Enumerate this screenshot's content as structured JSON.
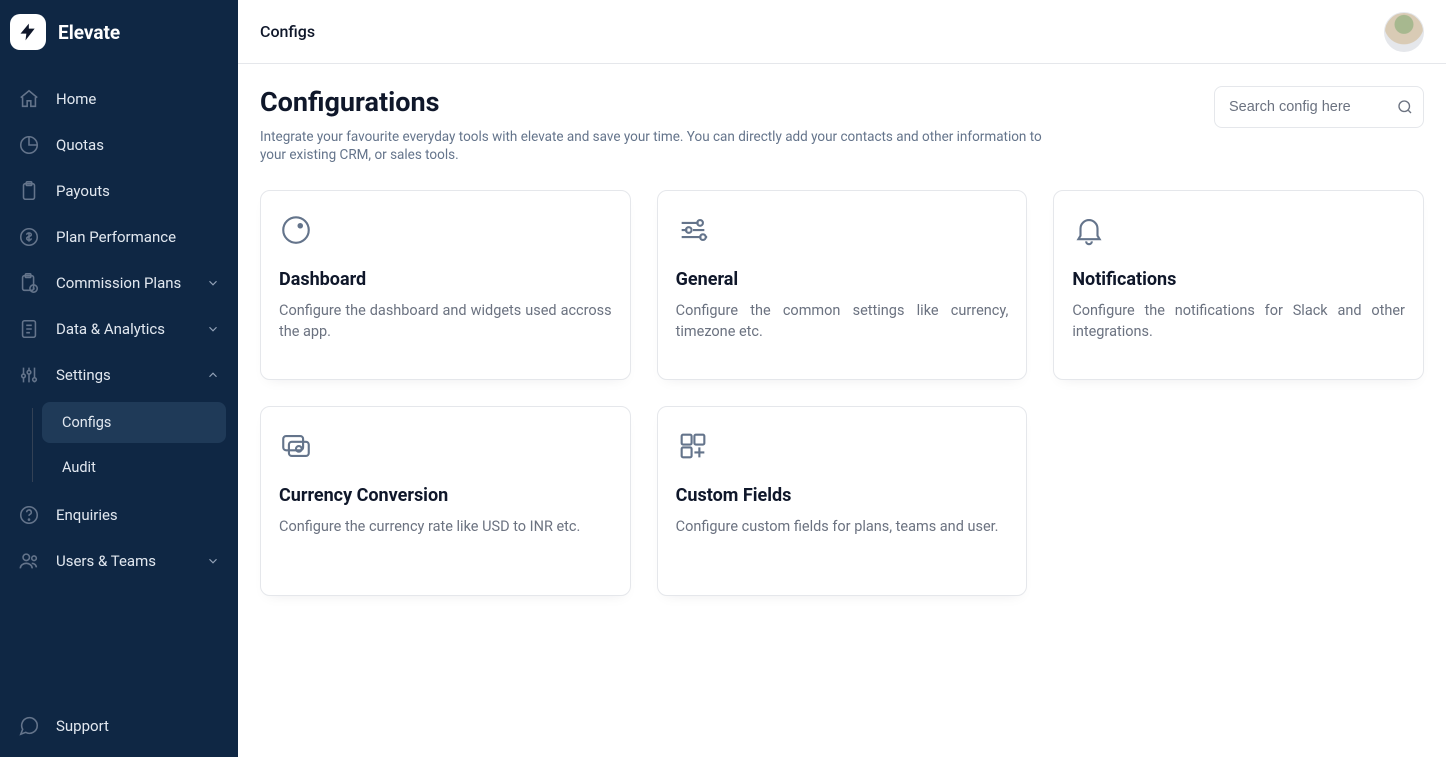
{
  "brand": {
    "name": "Elevate"
  },
  "sidebar": {
    "items": [
      {
        "label": "Home"
      },
      {
        "label": "Quotas"
      },
      {
        "label": "Payouts"
      },
      {
        "label": "Plan Performance"
      },
      {
        "label": "Commission Plans"
      },
      {
        "label": "Data & Analytics"
      },
      {
        "label": "Settings",
        "children": [
          {
            "label": "Configs",
            "active": true
          },
          {
            "label": "Audit"
          }
        ]
      },
      {
        "label": "Enquiries"
      },
      {
        "label": "Users & Teams"
      }
    ],
    "footer": {
      "label": "Support"
    }
  },
  "header": {
    "breadcrumb": "Configs"
  },
  "page": {
    "title": "Configurations",
    "subtitle": "Integrate your favourite everyday tools with elevate and save your time. You can directly add your contacts and other information to your existing CRM, or sales tools."
  },
  "search": {
    "placeholder": "Search config here"
  },
  "cards": [
    {
      "title": "Dashboard",
      "desc": "Configure the dashboard and widgets used accross the app."
    },
    {
      "title": "General",
      "desc": "Configure the common settings like currency, timezone etc."
    },
    {
      "title": "Notifications",
      "desc": "Configure the notifications for Slack and other integrations."
    },
    {
      "title": "Currency Conversion",
      "desc": "Configure the currency rate like USD to INR etc."
    },
    {
      "title": "Custom Fields",
      "desc": "Configure custom fields for plans, teams and user."
    }
  ]
}
